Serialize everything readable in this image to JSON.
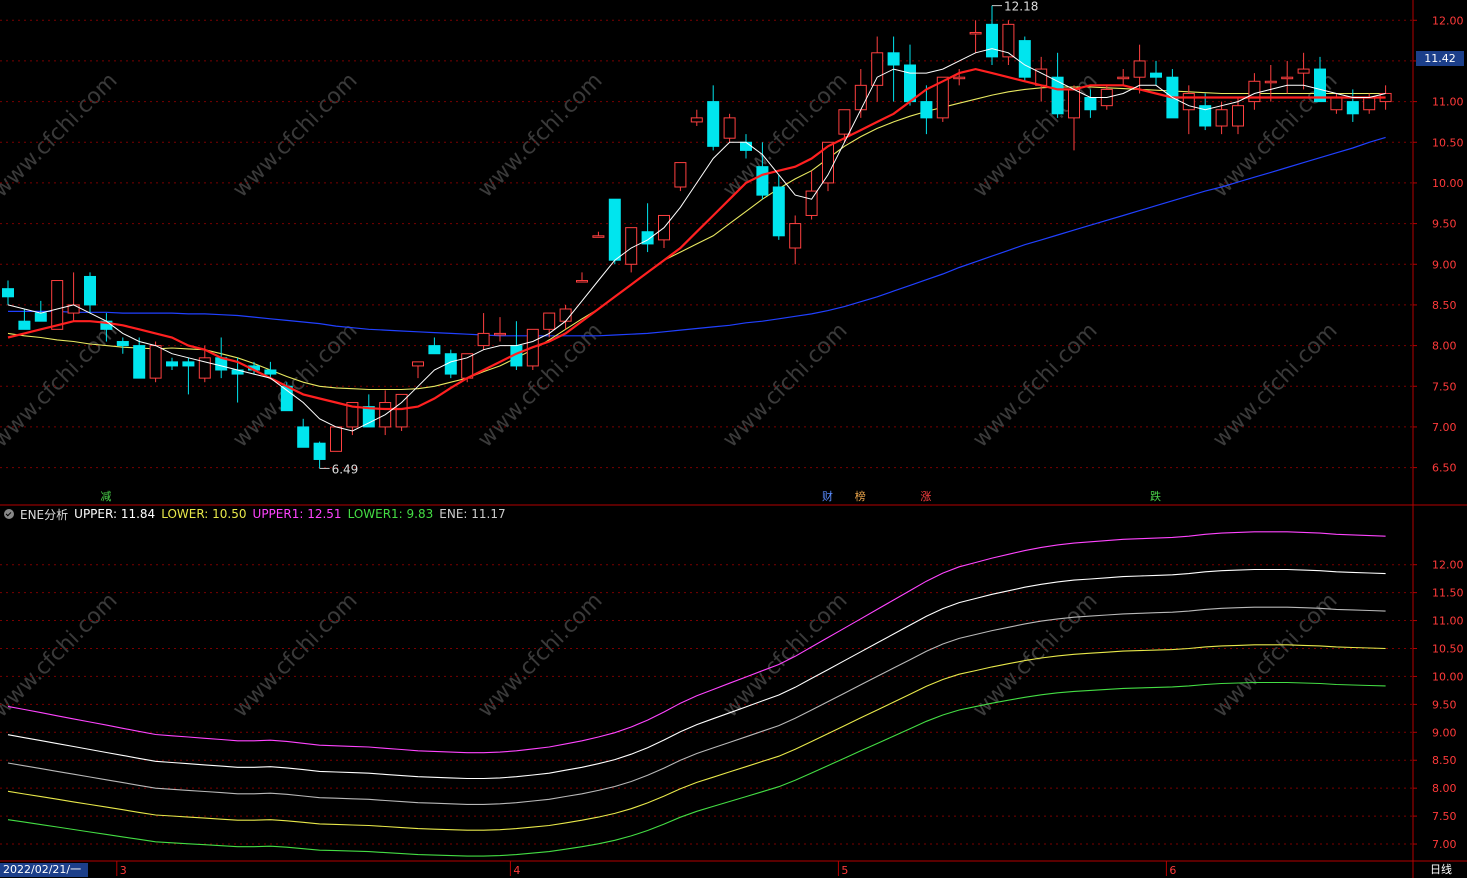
{
  "indicator": {
    "name": "ENE分析",
    "items": [
      {
        "label": "UPPER:",
        "value": "11.84",
        "color": "#ffffff"
      },
      {
        "label": "LOWER:",
        "value": "10.50",
        "color": "#e8e84a"
      },
      {
        "label": "UPPER1:",
        "value": "12.51",
        "color": "#ff44ff"
      },
      {
        "label": "LOWER1:",
        "value": "9.83",
        "color": "#44dd44"
      },
      {
        "label": "ENE:",
        "value": "11.17",
        "color": "#cccccc"
      }
    ]
  },
  "watermark": "www.cfchi.com",
  "current_price": "11.42",
  "start_date": "2022/02/21/一",
  "period_label": "日线",
  "month_labels": [
    "3",
    "4",
    "5",
    "6"
  ],
  "annotations": {
    "high": "12.18",
    "low": "6.49"
  },
  "event_markers": [
    {
      "text": "减",
      "color": "#4ad24a"
    },
    {
      "text": "财",
      "color": "#5a8cff"
    },
    {
      "text": "榜",
      "color": "#e8a34a"
    },
    {
      "text": "涨",
      "color": "#ff4040"
    },
    {
      "text": "跌",
      "color": "#4ad24a"
    }
  ],
  "colors": {
    "up": "#ff4040",
    "down": "#00e5ee",
    "ma5": "#ffffff",
    "ma10": "#ff2020",
    "ma20": "#e8e860",
    "ma60": "#2040ff",
    "grid": "#7a0000",
    "axis": "#b40000"
  },
  "chart_data": [
    {
      "type": "candlestick",
      "title": "",
      "yticks": [
        "12.00",
        "11.50",
        "11.00",
        "10.50",
        "10.00",
        "9.50",
        "9.00",
        "8.50",
        "8.00",
        "7.50",
        "7.00",
        "6.50"
      ],
      "ylim": [
        6.2,
        12.2
      ],
      "ohlc": [
        [
          8.7,
          8.8,
          8.6,
          8.5
        ],
        [
          8.3,
          8.45,
          8.2,
          8.3
        ],
        [
          8.4,
          8.55,
          8.3,
          8.35
        ],
        [
          8.2,
          8.8,
          8.8,
          8.2
        ],
        [
          8.4,
          8.9,
          8.5,
          8.3
        ],
        [
          8.85,
          8.9,
          8.5,
          8.4
        ],
        [
          8.3,
          8.4,
          8.2,
          8.05
        ],
        [
          8.05,
          8.1,
          8.0,
          7.9
        ],
        [
          8.0,
          8.1,
          7.6,
          7.6
        ],
        [
          7.6,
          8.05,
          8.0,
          7.55
        ],
        [
          7.8,
          7.85,
          7.75,
          7.7
        ],
        [
          7.8,
          7.85,
          7.75,
          7.4
        ],
        [
          7.6,
          8.0,
          7.85,
          7.55
        ],
        [
          7.85,
          8.1,
          7.7,
          7.6
        ],
        [
          7.7,
          7.85,
          7.65,
          7.3
        ],
        [
          7.75,
          7.8,
          7.7,
          7.65
        ],
        [
          7.7,
          7.8,
          7.65,
          7.6
        ],
        [
          7.5,
          7.55,
          7.2,
          7.2
        ],
        [
          7.0,
          7.1,
          6.75,
          6.75
        ],
        [
          6.8,
          6.82,
          6.6,
          6.49
        ],
        [
          6.7,
          7.0,
          7.0,
          6.7
        ],
        [
          7.0,
          7.3,
          7.3,
          6.9
        ],
        [
          7.25,
          7.4,
          7.0,
          7.0
        ],
        [
          7.0,
          7.45,
          7.3,
          6.9
        ],
        [
          7.0,
          7.4,
          7.4,
          6.95
        ],
        [
          7.75,
          7.8,
          7.8,
          7.6
        ],
        [
          8.0,
          8.1,
          7.9,
          7.9
        ],
        [
          7.9,
          7.95,
          7.65,
          7.6
        ],
        [
          7.6,
          7.9,
          7.9,
          7.55
        ],
        [
          8.0,
          8.4,
          8.15,
          7.95
        ],
        [
          8.15,
          8.35,
          8.15,
          8.05
        ],
        [
          8.0,
          8.3,
          7.75,
          7.7
        ],
        [
          7.75,
          8.2,
          8.2,
          7.7
        ],
        [
          8.2,
          8.25,
          8.4,
          8.1
        ],
        [
          8.3,
          8.5,
          8.45,
          8.2
        ],
        [
          8.8,
          8.9,
          8.8,
          8.8
        ],
        [
          9.35,
          9.4,
          9.35,
          9.35
        ],
        [
          9.8,
          9.8,
          9.05,
          9.0
        ],
        [
          9.0,
          9.15,
          9.45,
          8.9
        ],
        [
          9.4,
          9.75,
          9.25,
          9.15
        ],
        [
          9.3,
          9.6,
          9.6,
          9.2
        ],
        [
          9.95,
          10.25,
          10.25,
          9.9
        ],
        [
          10.75,
          10.9,
          10.8,
          10.7
        ],
        [
          11.0,
          11.2,
          10.45,
          10.4
        ],
        [
          10.55,
          10.85,
          10.8,
          10.5
        ],
        [
          10.5,
          10.6,
          10.4,
          10.3
        ],
        [
          10.2,
          10.5,
          9.85,
          9.8
        ],
        [
          9.95,
          10.1,
          9.35,
          9.3
        ],
        [
          9.2,
          9.6,
          9.5,
          9.0
        ],
        [
          9.6,
          10.15,
          9.9,
          9.55
        ],
        [
          10.0,
          10.5,
          10.5,
          9.9
        ],
        [
          10.6,
          10.9,
          10.9,
          10.5
        ],
        [
          10.9,
          11.4,
          11.2,
          10.8
        ],
        [
          11.2,
          11.8,
          11.6,
          11.0
        ],
        [
          11.6,
          11.8,
          11.45,
          11.0
        ],
        [
          11.45,
          11.7,
          11.0,
          10.95
        ],
        [
          11.0,
          11.2,
          10.8,
          10.6
        ],
        [
          10.8,
          11.3,
          11.3,
          10.75
        ],
        [
          11.3,
          11.4,
          11.3,
          11.2
        ],
        [
          11.85,
          12.0,
          11.85,
          11.6
        ],
        [
          11.95,
          12.18,
          11.55,
          11.45
        ],
        [
          11.55,
          12.0,
          11.95,
          11.45
        ],
        [
          11.75,
          11.8,
          11.3,
          11.25
        ],
        [
          11.2,
          11.55,
          11.4,
          11.0
        ],
        [
          11.3,
          11.6,
          10.85,
          10.8
        ],
        [
          10.8,
          11.2,
          11.15,
          10.4
        ],
        [
          11.05,
          11.15,
          10.9,
          10.8
        ],
        [
          10.95,
          11.2,
          11.15,
          10.9
        ],
        [
          11.3,
          11.4,
          11.3,
          11.2
        ],
        [
          11.3,
          11.7,
          11.5,
          11.1
        ],
        [
          11.35,
          11.5,
          11.3,
          11.2
        ],
        [
          11.3,
          11.4,
          10.8,
          10.8
        ],
        [
          10.9,
          11.2,
          11.1,
          10.6
        ],
        [
          10.95,
          11.1,
          10.7,
          10.65
        ],
        [
          10.7,
          11.0,
          10.9,
          10.6
        ],
        [
          10.7,
          11.05,
          10.95,
          10.6
        ],
        [
          11.0,
          11.35,
          11.25,
          10.9
        ],
        [
          11.25,
          11.45,
          11.25,
          11.0
        ],
        [
          11.3,
          11.5,
          11.3,
          11.1
        ],
        [
          11.35,
          11.6,
          11.4,
          11.15
        ],
        [
          11.4,
          11.55,
          11.0,
          11.0
        ],
        [
          10.9,
          11.1,
          11.05,
          10.85
        ],
        [
          11.0,
          11.15,
          10.85,
          10.75
        ],
        [
          10.9,
          11.1,
          11.05,
          10.85
        ],
        [
          11.0,
          11.2,
          11.1,
          10.9
        ]
      ],
      "ma5": [
        8.5,
        8.45,
        8.4,
        8.45,
        8.5,
        8.4,
        8.3,
        8.15,
        8.05,
        8.0,
        7.9,
        7.85,
        7.8,
        7.75,
        7.7,
        7.65,
        7.6,
        7.45,
        7.3,
        7.1,
        7.0,
        6.95,
        7.05,
        7.15,
        7.3,
        7.5,
        7.7,
        7.8,
        7.85,
        7.95,
        8.0,
        8.0,
        8.05,
        8.15,
        8.3,
        8.55,
        8.8,
        9.05,
        9.2,
        9.3,
        9.45,
        9.7,
        10.0,
        10.3,
        10.5,
        10.5,
        10.35,
        10.1,
        9.85,
        9.8,
        10.1,
        10.5,
        10.9,
        11.3,
        11.4,
        11.35,
        11.35,
        11.4,
        11.5,
        11.6,
        11.65,
        11.6,
        11.45,
        11.35,
        11.25,
        11.15,
        11.05,
        11.05,
        11.1,
        11.2,
        11.2,
        11.05,
        10.95,
        10.9,
        10.95,
        11.0,
        11.1,
        11.15,
        11.2,
        11.2,
        11.15,
        11.1,
        11.05,
        11.05,
        11.1
      ],
      "ma10": [
        8.1,
        8.15,
        8.2,
        8.25,
        8.3,
        8.3,
        8.28,
        8.25,
        8.2,
        8.15,
        8.1,
        8.0,
        7.95,
        7.85,
        7.8,
        7.7,
        7.6,
        7.5,
        7.4,
        7.35,
        7.3,
        7.25,
        7.23,
        7.22,
        7.22,
        7.25,
        7.35,
        7.48,
        7.6,
        7.7,
        7.8,
        7.9,
        7.98,
        8.05,
        8.15,
        8.3,
        8.45,
        8.6,
        8.75,
        8.9,
        9.05,
        9.2,
        9.4,
        9.6,
        9.8,
        10.0,
        10.1,
        10.15,
        10.2,
        10.3,
        10.45,
        10.55,
        10.65,
        10.75,
        10.85,
        11.0,
        11.15,
        11.25,
        11.35,
        11.4,
        11.35,
        11.3,
        11.25,
        11.2,
        11.15,
        11.15,
        11.2,
        11.2,
        11.2,
        11.15,
        11.1,
        11.05,
        11.05,
        11.05,
        11.05,
        11.05,
        11.05,
        11.05,
        11.05,
        11.05,
        11.05,
        11.05,
        11.05,
        11.05,
        11.05
      ],
      "ma20": [
        8.15,
        8.12,
        8.1,
        8.07,
        8.05,
        8.02,
        8.0,
        7.98,
        7.97,
        7.96,
        7.97,
        7.96,
        7.95,
        7.9,
        7.85,
        7.78,
        7.7,
        7.62,
        7.55,
        7.5,
        7.48,
        7.47,
        7.46,
        7.46,
        7.46,
        7.47,
        7.5,
        7.55,
        7.6,
        7.68,
        7.75,
        7.85,
        7.95,
        8.07,
        8.2,
        8.33,
        8.45,
        8.6,
        8.75,
        8.9,
        9.05,
        9.15,
        9.25,
        9.35,
        9.5,
        9.65,
        9.8,
        9.93,
        10.05,
        10.15,
        10.3,
        10.45,
        10.57,
        10.67,
        10.75,
        10.82,
        10.88,
        10.93,
        10.98,
        11.03,
        11.08,
        11.12,
        11.15,
        11.17,
        11.18,
        11.18,
        11.18,
        11.17,
        11.16,
        11.15,
        11.14,
        11.13,
        11.12,
        11.11,
        11.1,
        11.1,
        11.1,
        11.1,
        11.1,
        11.1,
        11.1,
        11.1,
        11.1,
        11.1,
        11.1
      ],
      "ma60": [
        8.42,
        8.42,
        8.42,
        8.42,
        8.41,
        8.41,
        8.41,
        8.4,
        8.4,
        8.4,
        8.4,
        8.39,
        8.39,
        8.38,
        8.37,
        8.35,
        8.33,
        8.31,
        8.29,
        8.27,
        8.24,
        8.22,
        8.2,
        8.19,
        8.18,
        8.17,
        8.16,
        8.15,
        8.14,
        8.13,
        8.12,
        8.12,
        8.12,
        8.12,
        8.12,
        8.12,
        8.12,
        8.13,
        8.14,
        8.15,
        8.17,
        8.19,
        8.21,
        8.23,
        8.25,
        8.28,
        8.3,
        8.33,
        8.36,
        8.39,
        8.43,
        8.48,
        8.54,
        8.6,
        8.67,
        8.74,
        8.81,
        8.88,
        8.96,
        9.03,
        9.1,
        9.17,
        9.24,
        9.3,
        9.36,
        9.42,
        9.48,
        9.54,
        9.6,
        9.66,
        9.72,
        9.78,
        9.84,
        9.9,
        9.95,
        10.01,
        10.07,
        10.13,
        10.19,
        10.25,
        10.31,
        10.37,
        10.43,
        10.5,
        10.56
      ]
    },
    {
      "type": "line",
      "title": "ENE分析",
      "yticks": [
        "12.00",
        "11.50",
        "11.00",
        "10.50",
        "10.00",
        "9.50",
        "9.00",
        "8.50",
        "8.00",
        "7.50",
        "7.00"
      ],
      "ylim": [
        6.75,
        12.8
      ],
      "ene": [
        8.45,
        8.4,
        8.35,
        8.3,
        8.25,
        8.2,
        8.15,
        8.1,
        8.05,
        8.0,
        7.98,
        7.96,
        7.94,
        7.92,
        7.9,
        7.9,
        7.91,
        7.89,
        7.86,
        7.83,
        7.82,
        7.81,
        7.8,
        7.78,
        7.76,
        7.74,
        7.73,
        7.72,
        7.71,
        7.71,
        7.72,
        7.74,
        7.77,
        7.8,
        7.85,
        7.9,
        7.96,
        8.03,
        8.12,
        8.23,
        8.36,
        8.5,
        8.62,
        8.72,
        8.82,
        8.92,
        9.02,
        9.12,
        9.25,
        9.4,
        9.55,
        9.7,
        9.85,
        10.0,
        10.15,
        10.3,
        10.45,
        10.58,
        10.68,
        10.75,
        10.82,
        10.88,
        10.94,
        10.99,
        11.03,
        11.06,
        11.08,
        11.1,
        11.12,
        11.13,
        11.14,
        11.15,
        11.17,
        11.2,
        11.22,
        11.23,
        11.24,
        11.24,
        11.24,
        11.23,
        11.22,
        11.2,
        11.19,
        11.18,
        11.17
      ]
    }
  ]
}
